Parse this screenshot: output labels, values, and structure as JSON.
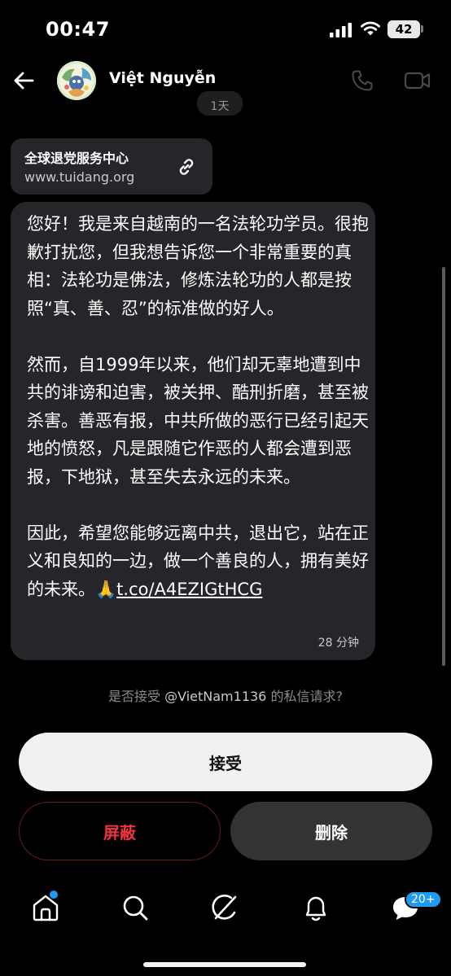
{
  "status_bar": {
    "time": "00:47",
    "battery": "42"
  },
  "header": {
    "contact_name": "Việt Nguyễn",
    "back_icon": "arrow-left-icon",
    "call_icon": "phone-icon",
    "video_icon": "video-camera-icon"
  },
  "chat": {
    "date_pill": "1天",
    "link_card": {
      "title": "全球退党服务中心",
      "url": "www.tuidang.org",
      "icon": "link-icon"
    },
    "message": {
      "text": "您好！我是来自越南的一名法轮功学员。很抱歉打扰您，但我想告诉您一个非常重要的真相：法轮功是佛法，修炼法轮功的人都是按照“真、善、忍”的标准做的好人。\n\n然而，自1999年以来，他们却无辜地遭到中共的诽谤和迫害，被关押、酷刑折磨，甚至被杀害。善恶有报，中共所做的恶行已经引起天地的愤怒，凡是跟随它作恶的人都会遭到恶报，下地狱，甚至失去永远的未来。\n\n因此，希望您能够远离中共，退出它，站在正义和良知的一边，做一个善良的人，拥有美好的未来。🙏",
      "link": "t.co/A4EZIGtHCG",
      "time": "28 分钟"
    }
  },
  "request": {
    "prefix": "是否接受 ",
    "handle": "@VietNam1136",
    "suffix": " 的私信请求?"
  },
  "buttons": {
    "accept": "接受",
    "block": "屏蔽",
    "delete": "删除"
  },
  "nav": {
    "items": [
      "home-icon",
      "search-icon",
      "grok-icon",
      "notifications-bell-icon",
      "messages-icon"
    ],
    "messages_badge": "20+"
  },
  "colors": {
    "accent": "#1d9bf0",
    "danger": "#ef3340",
    "bubble": "#26262a"
  }
}
